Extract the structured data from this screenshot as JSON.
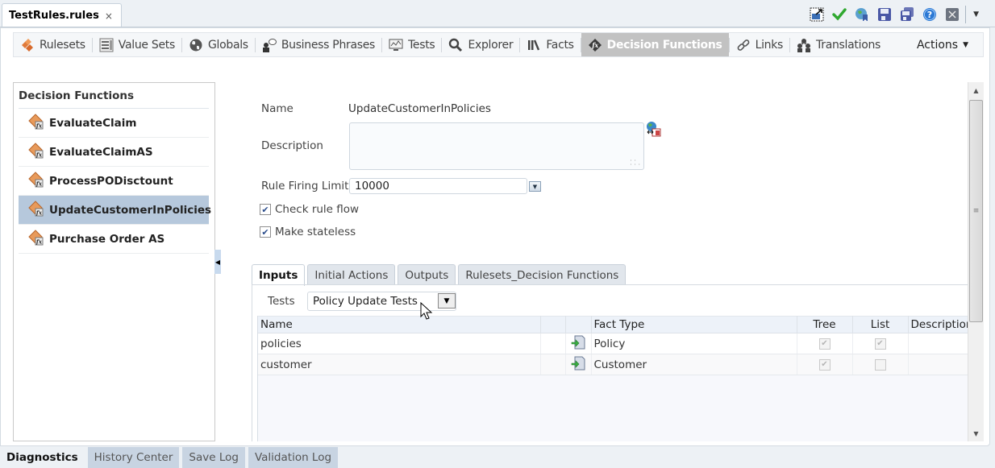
{
  "file_tab": {
    "label": "TestRules.rules",
    "close": "×"
  },
  "toolbar_icons": [
    {
      "name": "edit-table-icon"
    },
    {
      "name": "validate-check-icon"
    },
    {
      "name": "globe-bookmark-icon"
    },
    {
      "name": "save-icon"
    },
    {
      "name": "save-all-icon"
    },
    {
      "name": "help-icon"
    },
    {
      "name": "close-editor-icon"
    }
  ],
  "nav": {
    "items": [
      {
        "label": "Rulesets",
        "icon": "rulesets-icon"
      },
      {
        "label": "Value Sets",
        "icon": "value-sets-icon"
      },
      {
        "label": "Globals",
        "icon": "globe-icon"
      },
      {
        "label": "Business Phrases",
        "icon": "business-phrases-icon"
      },
      {
        "label": "Tests",
        "icon": "tests-icon"
      },
      {
        "label": "Explorer",
        "icon": "search-icon"
      },
      {
        "label": "Facts",
        "icon": "facts-icon"
      },
      {
        "label": "Decision Functions",
        "icon": "decision-function-icon",
        "active": true
      },
      {
        "label": "Links",
        "icon": "link-icon"
      },
      {
        "label": "Translations",
        "icon": "translations-icon"
      }
    ],
    "actions_label": "Actions"
  },
  "left_panel": {
    "title": "Decision Functions",
    "items": [
      {
        "label": "EvaluateClaim"
      },
      {
        "label": "EvaluateClaimAS"
      },
      {
        "label": "ProcessPODisctount"
      },
      {
        "label": "UpdateCustomerInPolicies",
        "selected": true
      },
      {
        "label": "Purchase Order AS"
      }
    ]
  },
  "form": {
    "name_label": "Name",
    "name_value": "UpdateCustomerInPolicies",
    "description_label": "Description",
    "description_value": "",
    "limit_label": "Rule Firing Limit",
    "limit_value": "10000",
    "check_rule_flow_label": "Check rule flow",
    "check_rule_flow_checked": true,
    "make_stateless_label": "Make stateless",
    "make_stateless_checked": true
  },
  "tabs": [
    {
      "label": "Inputs",
      "active": true
    },
    {
      "label": "Initial Actions"
    },
    {
      "label": "Outputs"
    },
    {
      "label": "Rulesets_Decision Functions"
    }
  ],
  "inputs": {
    "tests_label": "Tests",
    "tests_value": "Policy Update Tests",
    "columns": [
      "Name",
      "",
      "",
      "Fact Type",
      "Tree",
      "List",
      "Description"
    ],
    "rows": [
      {
        "name": "policies",
        "fact_type": "Policy",
        "tree": true,
        "list": true,
        "description": ""
      },
      {
        "name": "customer",
        "fact_type": "Customer",
        "tree": true,
        "list": false,
        "description": ""
      }
    ]
  },
  "bottom_tabs": [
    {
      "label": "Diagnostics",
      "active": true
    },
    {
      "label": "History Center"
    },
    {
      "label": "Save Log"
    },
    {
      "label": "Validation Log"
    }
  ]
}
